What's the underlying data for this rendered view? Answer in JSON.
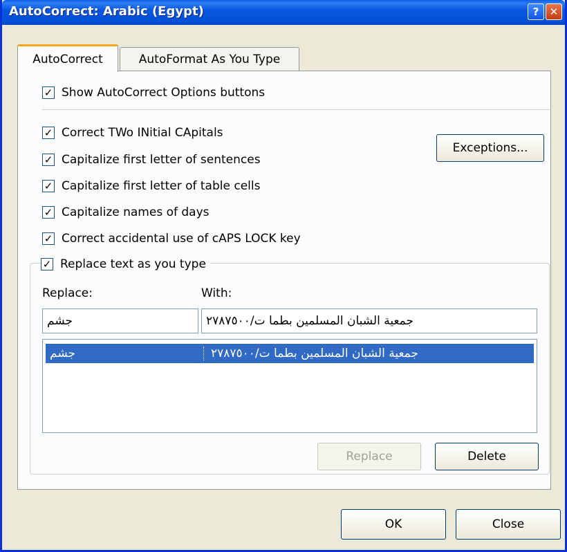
{
  "window": {
    "title": "AutoCorrect: Arabic (Egypt)",
    "help_glyph": "?",
    "close_glyph": "✕"
  },
  "tabs": [
    {
      "label": "AutoCorrect",
      "active": true
    },
    {
      "label": "AutoFormat As You Type",
      "active": false
    }
  ],
  "options": {
    "show_buttons": {
      "label": "Show AutoCorrect Options buttons",
      "checked": true
    },
    "items": [
      {
        "label": "Correct TWo INitial CApitals",
        "checked": true
      },
      {
        "label": "Capitalize first letter of sentences",
        "checked": true
      },
      {
        "label": "Capitalize first letter of table cells",
        "checked": true
      },
      {
        "label": "Capitalize names of days",
        "checked": true
      },
      {
        "label": "Correct accidental use of cAPS LOCK key",
        "checked": true
      }
    ],
    "exceptions_label": "Exceptions...",
    "replace_as_type": {
      "label": "Replace text as you type",
      "checked": true
    }
  },
  "replace": {
    "replace_label": "Replace:",
    "with_label": "With:",
    "replace_value": "جشم",
    "with_value": "جمعية الشبان المسلمين بطما ت/٢٧٨٧٥٠٠",
    "entries": [
      {
        "replace": "جشم",
        "with": "جمعية الشبان المسلمين بطما ت/٢٧٨٧٥٠٠"
      }
    ],
    "replace_button": "Replace",
    "delete_button": "Delete"
  },
  "footer": {
    "ok": "OK",
    "close": "Close"
  },
  "colors": {
    "titlebar": "#0a58e0",
    "selection": "#316ac5",
    "dialog_bg": "#ece9d8"
  }
}
